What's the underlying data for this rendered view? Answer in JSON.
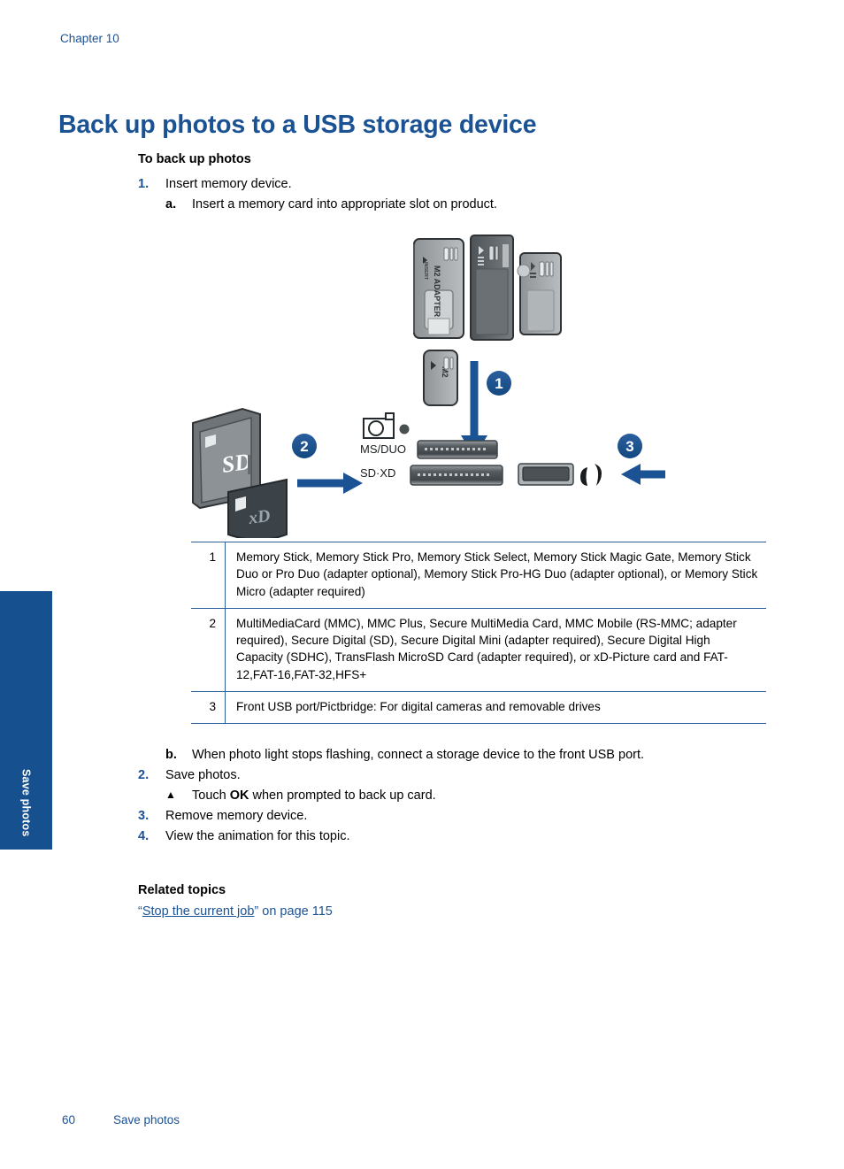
{
  "header": {
    "chapter": "Chapter 10",
    "title": "Back up photos to a USB storage device"
  },
  "side_tab": {
    "label": "Save photos",
    "color": "#17508f"
  },
  "procedure": {
    "heading": "To back up photos",
    "steps": [
      {
        "num": "1.",
        "text": "Insert memory device."
      },
      {
        "num": "2.",
        "text": "Save photos."
      },
      {
        "num": "3.",
        "text": "Remove memory device."
      },
      {
        "num": "4.",
        "text": "View the animation for this topic."
      }
    ],
    "substep_a": {
      "marker": "a",
      "text": "Insert a memory card into appropriate slot on product."
    },
    "substep_b": {
      "marker": "b",
      "text": "When photo light stops flashing, connect a storage device to the front USB port."
    },
    "substep_touch": {
      "bullet": "▲",
      "prefix": "Touch ",
      "strong": "OK",
      "suffix": " when prompted to back up card."
    }
  },
  "figure": {
    "callouts": [
      "1",
      "2",
      "3"
    ],
    "slot_labels": [
      "MS/DUO",
      "SD·XD"
    ],
    "card_labels": {
      "m2_adapter": "M2 ADAPTER",
      "m2_adapter_insert": "INSERT",
      "m2": "M2",
      "sd": "SD",
      "xd": "xD"
    },
    "icons": {
      "camera": "camera-icon",
      "led": "photo-light-led",
      "usb_port": "usb-port",
      "pictbridge": "pictbridge-icon"
    },
    "accent_color": "#1b5294"
  },
  "card_table": {
    "rows": [
      {
        "index": "1",
        "description": "Memory Stick, Memory Stick Pro, Memory Stick Select, Memory Stick Magic Gate, Memory Stick Duo or Pro Duo (adapter optional), Memory Stick Pro-HG Duo (adapter optional), or Memory Stick Micro (adapter required)"
      },
      {
        "index": "2",
        "description": "MultiMediaCard (MMC), MMC Plus, Secure MultiMedia Card, MMC Mobile (RS-MMC; adapter required), Secure Digital (SD), Secure Digital Mini (adapter required), Secure Digital High Capacity (SDHC), TransFlash MicroSD Card (adapter required), or xD-Picture card and FAT-12,FAT-16,FAT-32,HFS+"
      },
      {
        "index": "3",
        "description": "Front USB port/Pictbridge: For digital cameras and removable drives"
      }
    ]
  },
  "related_topics": {
    "heading": "Related topics",
    "link_open_quote": "“",
    "link_text": "Stop the current job",
    "link_close_quote": "”",
    "link_suffix": " on page 115"
  },
  "footer": {
    "page_number": "60",
    "section": "Save photos"
  }
}
